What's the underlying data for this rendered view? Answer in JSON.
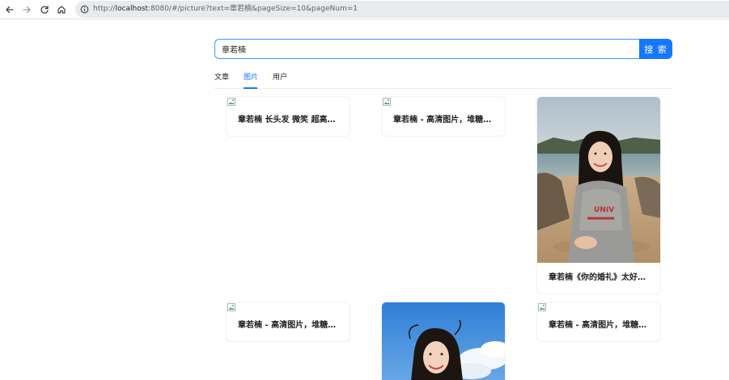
{
  "browser": {
    "url_scheme": "http://",
    "url_host": "localhost",
    "url_rest": ":8080/#/picture?text=章若楠&pageSize=10&pageNum=1"
  },
  "search": {
    "value": "章若楠",
    "button_label": "搜 索"
  },
  "tabs": [
    {
      "label": "文章",
      "active": false
    },
    {
      "label": "图片",
      "active": true
    },
    {
      "label": "用户",
      "active": false
    }
  ],
  "cards": [
    {
      "title": "章若楠 长头发 微笑 超高清..."
    },
    {
      "title": "章若楠 - 高清图片，堆糖，..."
    },
    {
      "title": "章若楠《你的婚礼》太好哭..."
    },
    {
      "title": "章若楠 - 高清图片，堆糖，..."
    },
    {
      "title": "章若楠 - 高清图片，堆糖，..."
    }
  ],
  "colors": {
    "accent": "#1677ff",
    "input_border": "#4096ff"
  },
  "icons": [
    "back-arrow-icon",
    "forward-arrow-icon",
    "reload-icon",
    "home-icon",
    "site-info-icon",
    "broken-image-icon"
  ]
}
